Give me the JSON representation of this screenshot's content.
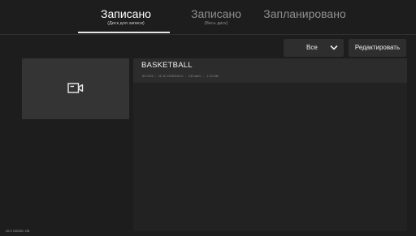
{
  "tabs": [
    {
      "title": "Записано",
      "subtitle": "(Диск для записи)",
      "active": true
    },
    {
      "title": "Записано",
      "subtitle": "(Весь диск)",
      "active": false
    },
    {
      "title": "Запланировано",
      "subtitle": "",
      "active": false
    }
  ],
  "toolbar": {
    "filter_value": "Все",
    "edit_label": "Редактировать"
  },
  "recordings": [
    {
      "title": "BASKETBALL",
      "channel": "53 CH3",
      "datetime": "11:10 2018/10/12",
      "duration": "133 мин.",
      "size": "1.24 GB"
    }
  ],
  "storage": "26.9 GB/500 GB",
  "icons": {
    "thumbnail": "video-camera-icon",
    "filter": "chevron-down-icon"
  },
  "colors": {
    "background": "#1d1d1d",
    "panel": "#222222",
    "row": "#2c2c2c",
    "button": "#2e2e2e",
    "accent": "#e8e8e8"
  }
}
